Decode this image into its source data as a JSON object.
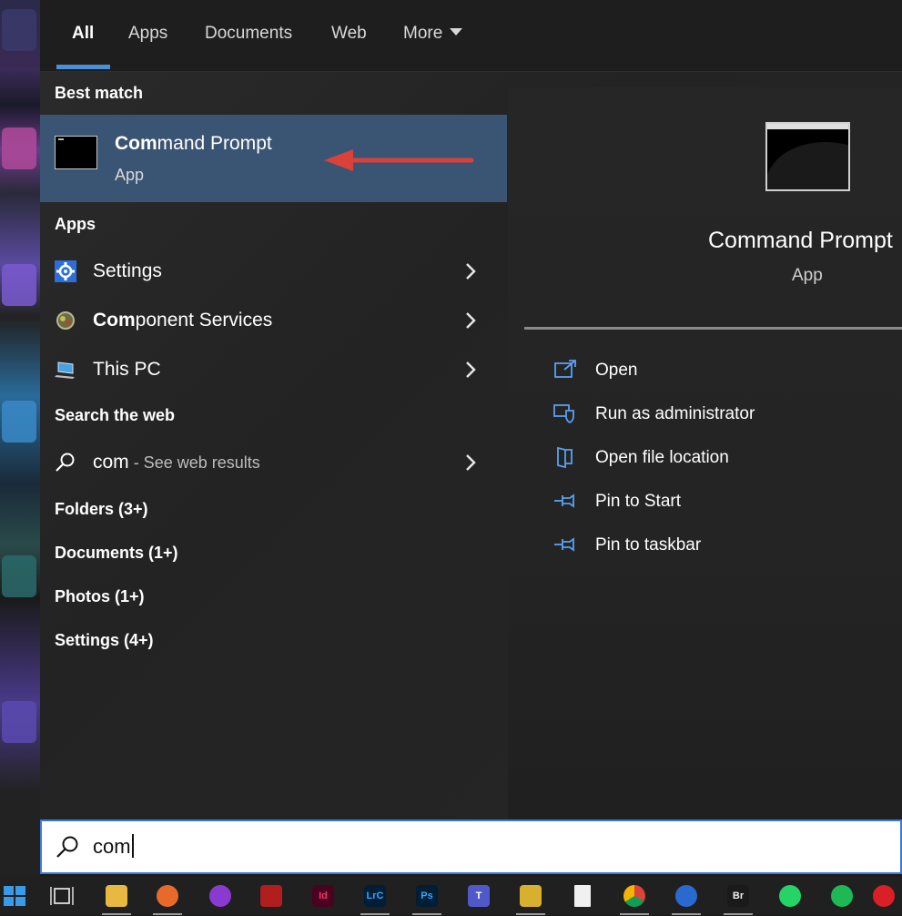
{
  "tabs": [
    {
      "label": "All"
    },
    {
      "label": "Apps"
    },
    {
      "label": "Documents"
    },
    {
      "label": "Web"
    },
    {
      "label": "More"
    }
  ],
  "best_match": {
    "heading": "Best match",
    "title_bold": "Com",
    "title_rest": "mand Prompt",
    "subtitle": "App"
  },
  "apps": {
    "heading": "Apps",
    "items": [
      {
        "bold": "",
        "rest": "Settings",
        "icon": "gear-icon"
      },
      {
        "bold": "Com",
        "rest": "ponent Services",
        "icon": "component-services-icon"
      },
      {
        "bold": "",
        "rest": "This PC",
        "icon": "computer-icon"
      }
    ]
  },
  "web": {
    "heading": "Search the web",
    "query": "com",
    "suffix": " - See web results"
  },
  "categories": [
    {
      "label": "Folders (3+)"
    },
    {
      "label": "Documents (1+)"
    },
    {
      "label": "Photos (1+)"
    },
    {
      "label": "Settings (4+)"
    }
  ],
  "detail": {
    "title": "Command Prompt",
    "subtitle": "App",
    "actions": [
      {
        "label": "Open",
        "icon": "open-icon"
      },
      {
        "label": "Run as administrator",
        "icon": "shield-icon"
      },
      {
        "label": "Open file location",
        "icon": "file-location-icon"
      },
      {
        "label": "Pin to Start",
        "icon": "pin-icon"
      },
      {
        "label": "Pin to taskbar",
        "icon": "pin-icon"
      }
    ]
  },
  "search": {
    "value": "com"
  },
  "taskbar": {
    "items": [
      {
        "name": "start-button",
        "glyph": ""
      },
      {
        "name": "task-view-button",
        "glyph": ""
      },
      {
        "name": "file-explorer",
        "glyph": ""
      },
      {
        "name": "firefox",
        "glyph": ""
      },
      {
        "name": "app-purple",
        "glyph": ""
      },
      {
        "name": "acrobat",
        "glyph": ""
      },
      {
        "name": "indesign",
        "glyph": "Id"
      },
      {
        "name": "lightroom-classic",
        "glyph": "LrC"
      },
      {
        "name": "photoshop",
        "glyph": "Ps"
      },
      {
        "name": "teams",
        "glyph": "T"
      },
      {
        "name": "app-yellow",
        "glyph": ""
      },
      {
        "name": "notepad",
        "glyph": ""
      },
      {
        "name": "chrome",
        "glyph": ""
      },
      {
        "name": "thunderbird",
        "glyph": ""
      },
      {
        "name": "bridge",
        "glyph": "Br"
      },
      {
        "name": "whatsapp",
        "glyph": ""
      },
      {
        "name": "spotify",
        "glyph": ""
      },
      {
        "name": "creative-cloud",
        "glyph": ""
      }
    ]
  },
  "colors": {
    "accent": "#4a8fd8",
    "selection": "#3a5573",
    "arrow": "#d9413a"
  }
}
